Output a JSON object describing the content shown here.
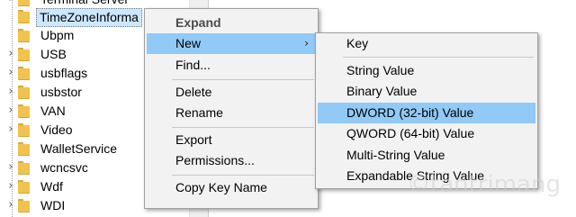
{
  "tree": {
    "items": [
      {
        "label": "Terminal Server",
        "has_children": true
      },
      {
        "label": "TimeZoneInforma",
        "has_children": false,
        "selected": true
      },
      {
        "label": "Ubpm",
        "has_children": false
      },
      {
        "label": "USB",
        "has_children": true
      },
      {
        "label": "usbflags",
        "has_children": true
      },
      {
        "label": "usbstor",
        "has_children": true
      },
      {
        "label": "VAN",
        "has_children": true
      },
      {
        "label": "Video",
        "has_children": true
      },
      {
        "label": "WalletService",
        "has_children": false
      },
      {
        "label": "wcncsvc",
        "has_children": true
      },
      {
        "label": "Wdf",
        "has_children": true
      },
      {
        "label": "WDI",
        "has_children": true
      }
    ]
  },
  "context_menu": {
    "expand": "Expand",
    "new": "New",
    "find": "Find...",
    "delete": "Delete",
    "rename": "Rename",
    "export": "Export",
    "permissions": "Permissions...",
    "copy_key_name": "Copy Key Name"
  },
  "new_submenu": {
    "key": "Key",
    "string_value": "String Value",
    "binary_value": "Binary Value",
    "dword_value": "DWORD (32-bit) Value",
    "qword_value": "QWORD (64-bit) Value",
    "multi_string_value": "Multi-String Value",
    "expandable_string_value": "Expandable String Value"
  },
  "watermark": "©tantrimang",
  "colors": {
    "highlight": "#91c9f7",
    "menu_bg": "#f2f2f2",
    "folder": "#f1c24e",
    "selected_tree": "#cce8ff"
  }
}
